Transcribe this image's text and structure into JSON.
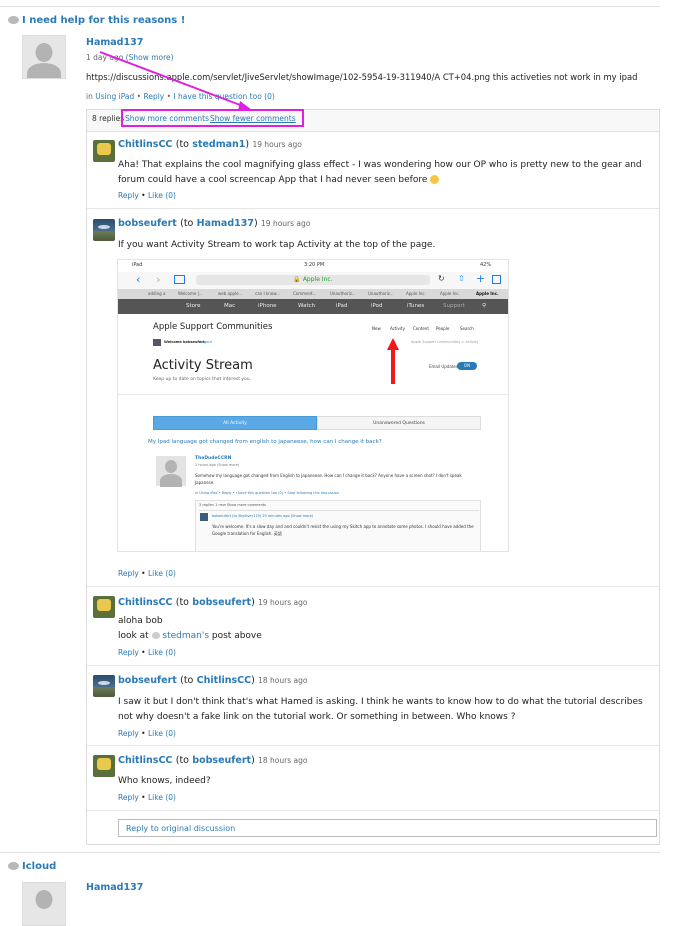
{
  "thread1": {
    "title": "I need help for this reasons !",
    "author": "Hamad137",
    "posted": "1 day ago",
    "show_more": "(Show more)",
    "body": "https://discussions.apple.com/servlet/JiveServlet/showImage/102-5954-19-311940/A CT+04.png   this activeties not work in my ipad",
    "in_prefix": "in",
    "community": "Using iPad",
    "actions": [
      "Reply",
      "I have this question too (0)"
    ],
    "replies_count": "8 replies",
    "show_more_comments": "Show more comments",
    "show_fewer_comments": "Show fewer comments"
  },
  "replies": [
    {
      "author": "ChitlinsCC",
      "to_prefix": "(to",
      "to": "stedman1",
      "to_suffix": ")",
      "time": "19 hours ago",
      "text": "Aha! That explains the cool magnifying glass effect - I was wondering how our OP who is pretty new to the gear and forum could have a cool screencap App that I had never seen before",
      "reply": "Reply",
      "like": "Like (0)"
    },
    {
      "author": "bobseufert",
      "to_prefix": "(to",
      "to": "Hamad137",
      "to_suffix": ")",
      "time": "19 hours ago",
      "text": "If you want Activity Stream to work tap Activity at the top of the page.",
      "reply": "Reply",
      "like": "Like (0)"
    },
    {
      "author": "ChitlinsCC",
      "to_prefix": "(to",
      "to": "bobseufert",
      "to_suffix": ")",
      "time": "19 hours ago",
      "line1": "aloha bob",
      "line2_prefix": "look at",
      "line2_link": "stedman's",
      "line2_suffix": "post above",
      "reply": "Reply",
      "like": "Like (0)"
    },
    {
      "author": "bobseufert",
      "to_prefix": "(to",
      "to": "ChitlinsCC",
      "to_suffix": ")",
      "time": "18 hours ago",
      "text": "I saw it but I don't think that's what Hamed is asking. I think he wants to know how to do what the tutorial describes not why doesn't a fake link on the tutorial work. Or something in between.  Who knows ?",
      "reply": "Reply",
      "like": "Like (0)"
    },
    {
      "author": "ChitlinsCC",
      "to_prefix": "(to",
      "to": "bobseufert",
      "to_suffix": ")",
      "time": "18 hours ago",
      "text": "Who knows, indeed?",
      "reply": "Reply",
      "like": "Like (0)"
    }
  ],
  "reply_original": "Reply to original discussion",
  "thread2": {
    "title": "Icloud",
    "author": "Hamad137"
  },
  "screenshot": {
    "status_left": "iPad",
    "status_time": "3:20 PM",
    "status_right": "42%",
    "url": "Apple Inc.",
    "tabs": [
      "adding a",
      "Welcome |...",
      "web apple...",
      "can I know...",
      "Comment...",
      "Unauthoriz...",
      "Unauthoriz...",
      "Apple Inc.",
      "Apple Inc.",
      "Apple Inc."
    ],
    "nav": [
      "Store",
      "Mac",
      "iPhone",
      "Watch",
      "iPad",
      "iPod",
      "iTunes",
      "Support"
    ],
    "site_title": "Apple Support Communities",
    "site_links": [
      "New",
      "Activity",
      "Content",
      "People",
      "Search"
    ],
    "welcome": "Welcome bobseufert",
    "logout": "Logout",
    "crumb": "Apple Support Communities > Activity",
    "stream_title": "Activity Stream",
    "stream_sub": "Keep up to date on topics that interest you.",
    "email_label": "Email Updates",
    "email_toggle": "ON",
    "tab_all": "All Activity",
    "tab_unanswered": "Unanswered Questions",
    "q_title": "My Ipad language got changed from english to japaneese, how can I change it back?",
    "q_author": "TheDudeCCRN",
    "q_time": "2 hours ago (Show more)",
    "q_body": "Somehow my language got changed from English to Japaneese. How can I change it back? Anyone have a screen shot? I don't speak Japanese.",
    "q_actions": "in Using iPad • Reply • I have this question too (0) • Stop following this discussion",
    "q_replies": "3 replies  1 new  Show more comments",
    "r_author": "bobseufert (to Skydiver119) 29 minutes ago (Show more)",
    "r_body": "You're welcome.  It's a slow day and and couldn't resist the using my Skitch app to annotate some photos. I should have added the Google translation for English.  英語"
  }
}
